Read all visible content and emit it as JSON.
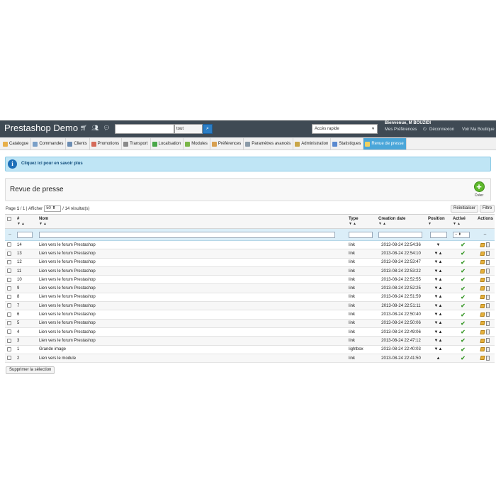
{
  "header": {
    "brand": "Prestashop Demo",
    "icons": [
      "cart-icon",
      "users-icon",
      "messages-icon"
    ],
    "search": {
      "value": "",
      "scope": "tout"
    },
    "quick_access": "Accès rapide",
    "welcome": "Bienvenue, M BOUZIDI",
    "links": {
      "preferences": "Mes Préférences",
      "logout": "Déconnexion",
      "shop": "Voir Ma Boutique"
    }
  },
  "menu": [
    {
      "label": "Catalogue",
      "color": "#e8b04a"
    },
    {
      "label": "Commandes",
      "color": "#7aa0c8"
    },
    {
      "label": "Clients",
      "color": "#6c8db3"
    },
    {
      "label": "Promotions",
      "color": "#d56b5a"
    },
    {
      "label": "Transport",
      "color": "#8a8a8a"
    },
    {
      "label": "Localisation",
      "color": "#4aa84a"
    },
    {
      "label": "Modules",
      "color": "#7ab648"
    },
    {
      "label": "Préférences",
      "color": "#d8a050"
    },
    {
      "label": "Paramètres avancés",
      "color": "#8a9aa8"
    },
    {
      "label": "Administration",
      "color": "#c9a648"
    },
    {
      "label": "Statistiques",
      "color": "#5a8ad0"
    },
    {
      "label": "Revue de presse",
      "color": "#f0d060",
      "active": true
    }
  ],
  "info": {
    "text": "Cliquez ici pour en savoir plus"
  },
  "page": {
    "title": "Revue de presse",
    "create": "Créer"
  },
  "pager": {
    "page": "Page",
    "current": "1",
    "of": "/ 1",
    "show": "| Afficher",
    "per_page": "50",
    "results": "/ 14 résultat(s)"
  },
  "actions": {
    "reset": "Réinitialiser",
    "filter": "Filtre",
    "bulk_delete": "Supprimer la sélection"
  },
  "table": {
    "columns": {
      "id": "#",
      "name": "Nom",
      "type": "Type",
      "date": "Creation date",
      "position": "Position",
      "active": "Activé",
      "actions": "Actions"
    },
    "filter_placeholders": {
      "select": "--",
      "active": "--"
    },
    "rows": [
      {
        "id": "14",
        "name": "Lien vers le forum Prestashop",
        "type": "link",
        "date": "2013-08-24 22:54:36",
        "pos": "▼"
      },
      {
        "id": "13",
        "name": "Lien vers le forum Prestashop",
        "type": "link",
        "date": "2013-08-24 22:54:10",
        "pos": "▼▲"
      },
      {
        "id": "12",
        "name": "Lien vers le forum Prestashop",
        "type": "link",
        "date": "2013-08-24 22:53:47",
        "pos": "▼▲"
      },
      {
        "id": "11",
        "name": "Lien vers le forum Prestashop",
        "type": "link",
        "date": "2013-08-24 22:53:22",
        "pos": "▼▲"
      },
      {
        "id": "10",
        "name": "Lien vers le forum Prestashop",
        "type": "link",
        "date": "2013-08-24 22:52:55",
        "pos": "▼▲"
      },
      {
        "id": "9",
        "name": "Lien vers le forum Prestashop",
        "type": "link",
        "date": "2013-08-24 22:52:25",
        "pos": "▼▲"
      },
      {
        "id": "8",
        "name": "Lien vers le forum Prestashop",
        "type": "link",
        "date": "2013-08-24 22:51:59",
        "pos": "▼▲"
      },
      {
        "id": "7",
        "name": "Lien vers le forum Prestashop",
        "type": "link",
        "date": "2013-08-24 22:51:11",
        "pos": "▼▲"
      },
      {
        "id": "6",
        "name": "Lien vers le forum Prestashop",
        "type": "link",
        "date": "2013-08-24 22:50:40",
        "pos": "▼▲"
      },
      {
        "id": "5",
        "name": "Lien vers le forum Prestashop",
        "type": "link",
        "date": "2013-08-24 22:50:06",
        "pos": "▼▲"
      },
      {
        "id": "4",
        "name": "Lien vers le forum Prestashop",
        "type": "link",
        "date": "2013-08-24 22:49:06",
        "pos": "▼▲"
      },
      {
        "id": "3",
        "name": "Lien vers le forum Prestashop",
        "type": "link",
        "date": "2013-08-24 22:47:12",
        "pos": "▼▲"
      },
      {
        "id": "1",
        "name": "Grande image",
        "type": "lightbox",
        "date": "2013-08-24 22:40:03",
        "pos": "▼▲"
      },
      {
        "id": "2",
        "name": "Lien vers le module",
        "type": "link",
        "date": "2013-08-24 22:41:50",
        "pos": "▲"
      }
    ]
  }
}
